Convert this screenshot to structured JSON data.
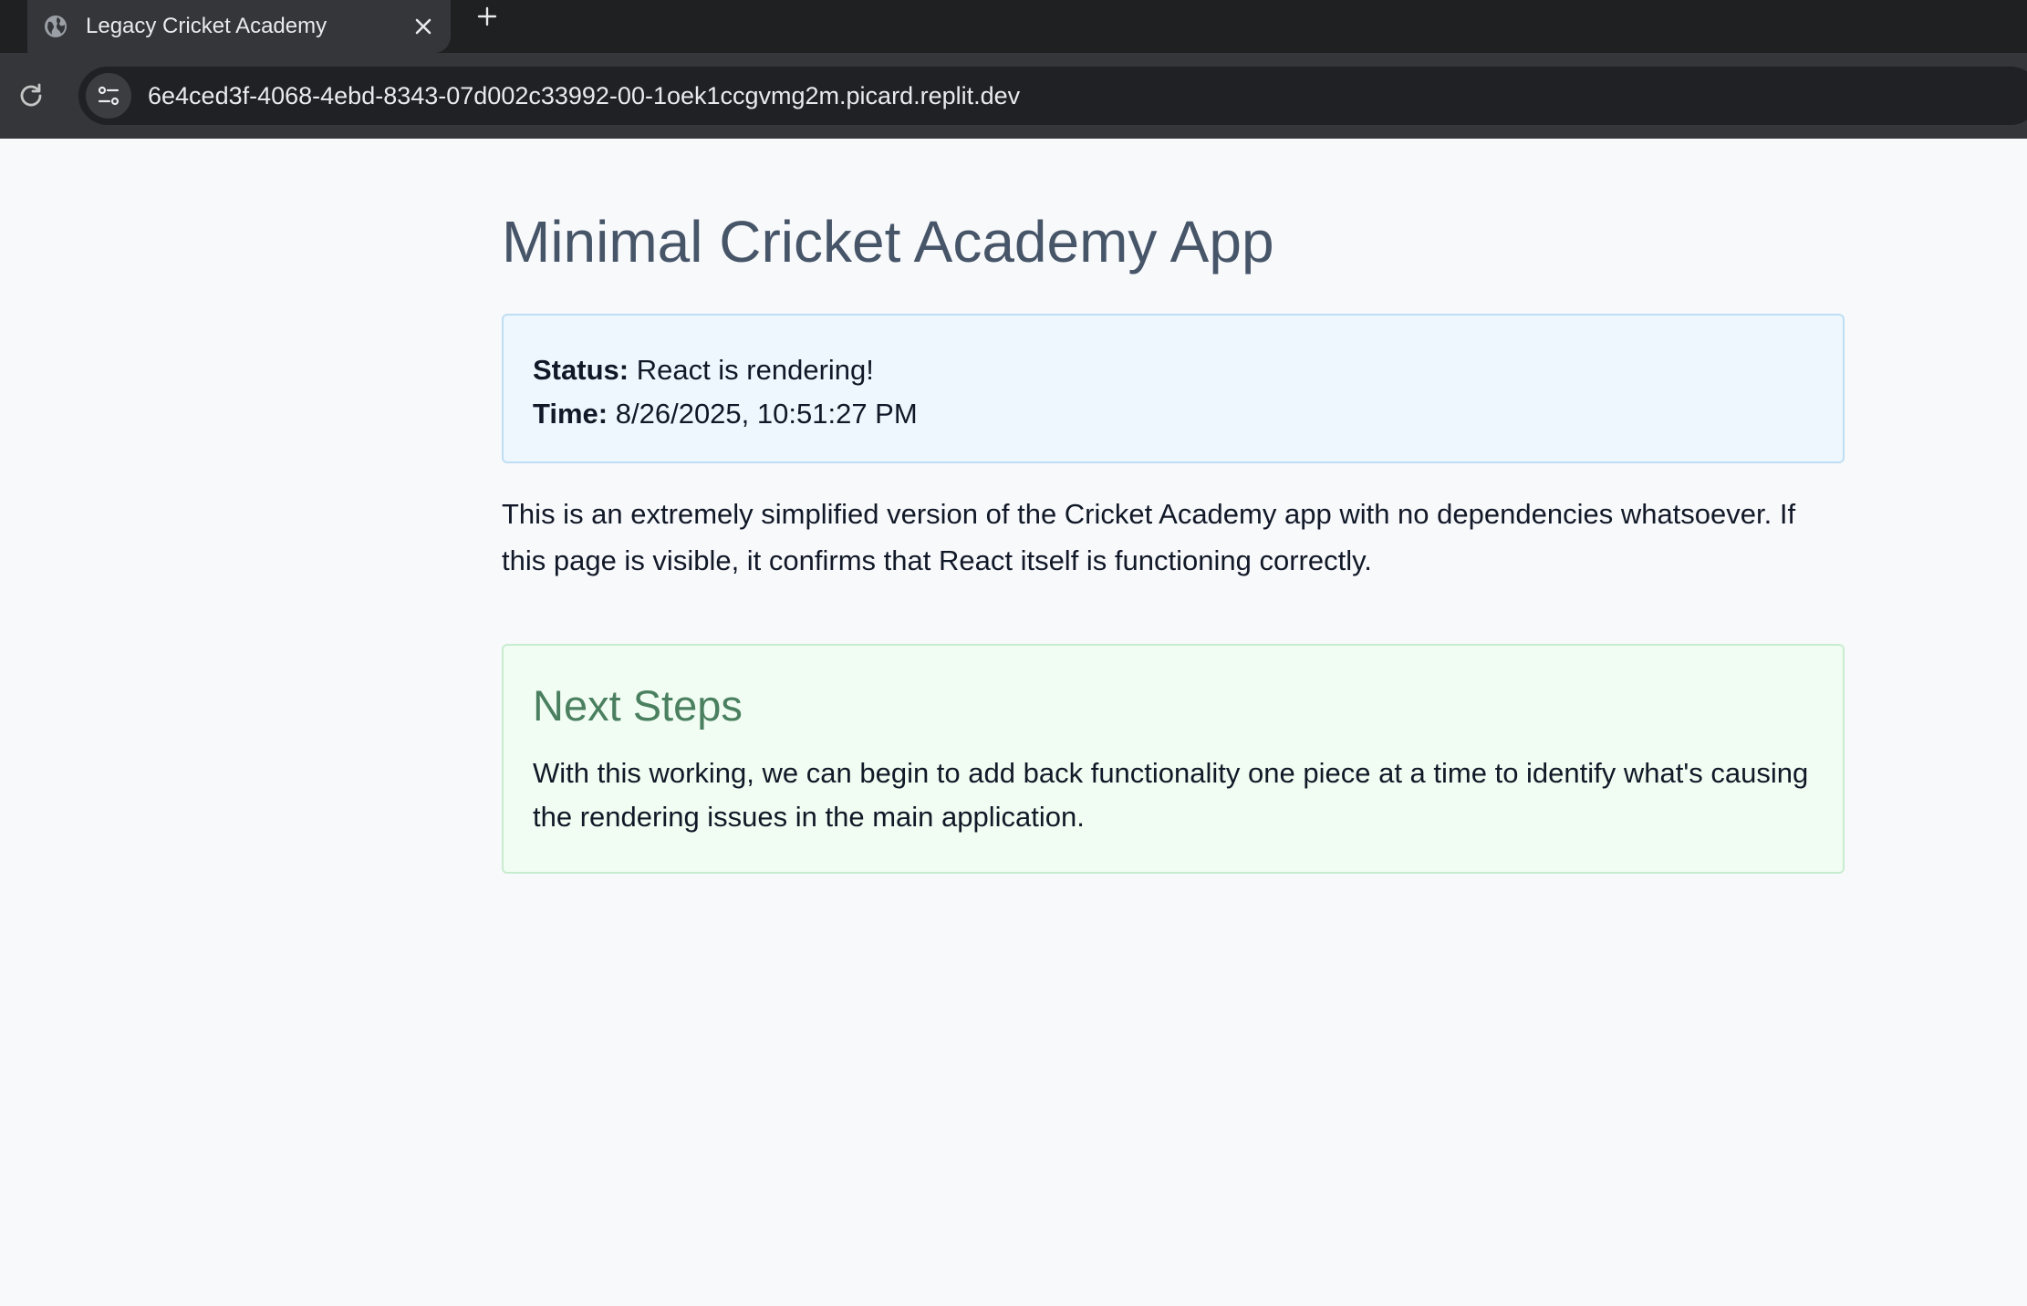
{
  "browser": {
    "tab": {
      "title": "Legacy Cricket Academy",
      "favicon": "globe-icon",
      "close_icon": "close-icon"
    },
    "new_tab_icon": "plus-icon",
    "reload_icon": "reload-icon",
    "site_info_icon": "tune-icon",
    "url": "6e4ced3f-4068-4ebd-8343-07d002c33992-00-1oek1ccgvmg2m.picard.replit.dev"
  },
  "page": {
    "title": "Minimal Cricket Academy App",
    "status": {
      "status_label": "Status:",
      "status_value": "React is rendering!",
      "time_label": "Time:",
      "time_value": "8/26/2025, 10:51:27 PM"
    },
    "description": "This is an extremely simplified version of the Cricket Academy app with no dependencies whatsoever. If this page is visible, it confirms that React itself is functioning correctly.",
    "next_steps": {
      "title": "Next Steps",
      "text": "With this working, we can begin to add back functionality one piece at a time to identify what's causing the rendering issues in the main application."
    }
  },
  "colors": {
    "title": "#475569",
    "status_bg": "#eef7fd",
    "status_border": "#bfdef3",
    "next_bg": "#f1fdf2",
    "next_border": "#c8ecd0",
    "next_title": "#4a8060"
  }
}
